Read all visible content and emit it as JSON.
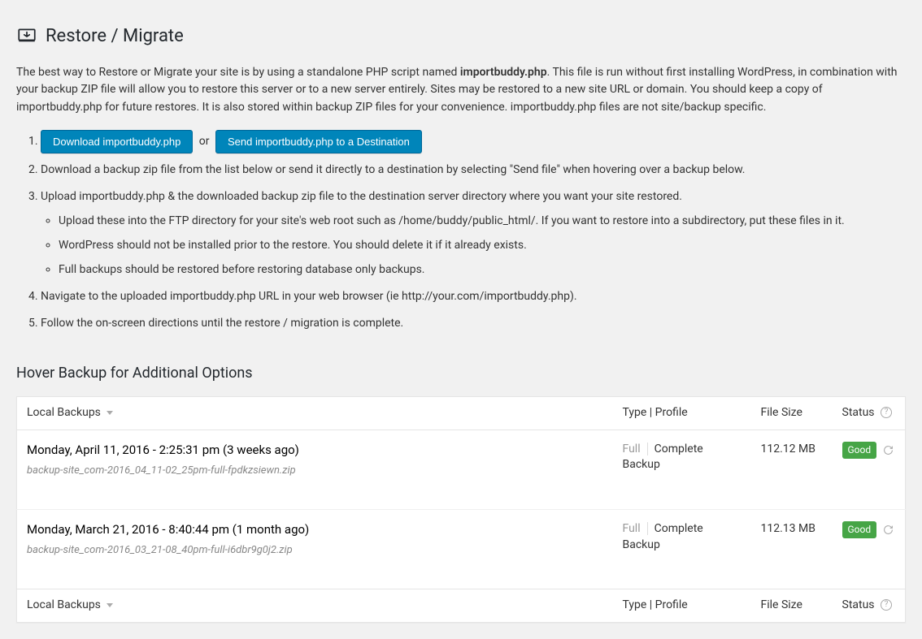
{
  "page": {
    "title": "Restore / Migrate"
  },
  "intro": {
    "prefix": "The best way to Restore or Migrate your site is by using a standalone PHP script named ",
    "script_name": "importbuddy.php",
    "suffix": ". This file is run without first installing WordPress, in combination with your backup ZIP file will allow you to restore this server or to a new server entirely. Sites may be restored to a new site URL or domain. You should keep a copy of importbuddy.php for future restores. It is also stored within backup ZIP files for your convenience. importbuddy.php files are not site/backup specific."
  },
  "buttons": {
    "download": "Download importbuddy.php",
    "or": "or",
    "send": "Send importbuddy.php to a Destination"
  },
  "steps": {
    "s2": "Download a backup zip file from the list below or send it directly to a destination by selecting \"Send file\" when hovering over a backup below.",
    "s3": "Upload importbuddy.php & the downloaded backup zip file to the destination server directory where you want your site restored.",
    "s3a": "Upload these into the FTP directory for your site's web root such as /home/buddy/public_html/. If you want to restore into a subdirectory, put these files in it.",
    "s3b": "WordPress should not be installed prior to the restore. You should delete it if it already exists.",
    "s3c": "Full backups should be restored before restoring database only backups.",
    "s4": "Navigate to the uploaded importbuddy.php URL in your web browser (ie http://your.com/importbuddy.php).",
    "s5": "Follow the on-screen directions until the restore / migration is complete."
  },
  "section_heading": "Hover Backup for Additional Options",
  "table": {
    "headers": {
      "local": "Local Backups",
      "type": "Type | Profile",
      "size": "File Size",
      "status": "Status"
    },
    "rows": [
      {
        "date": "Monday, April 11, 2016 - 2:25:31 pm (3 weeks ago)",
        "file": "backup-site_com-2016_04_11-02_25pm-full-fpdkzsiewn.zip",
        "type": "Full",
        "profile": "Complete Backup",
        "size": "112.12 MB",
        "status": "Good"
      },
      {
        "date": "Monday, March 21, 2016 - 8:40:44 pm (1 month ago)",
        "file": "backup-site_com-2016_03_21-08_40pm-full-i6dbr9g0j2.zip",
        "type": "Full",
        "profile": "Complete Backup",
        "size": "112.13 MB",
        "status": "Good"
      }
    ]
  }
}
